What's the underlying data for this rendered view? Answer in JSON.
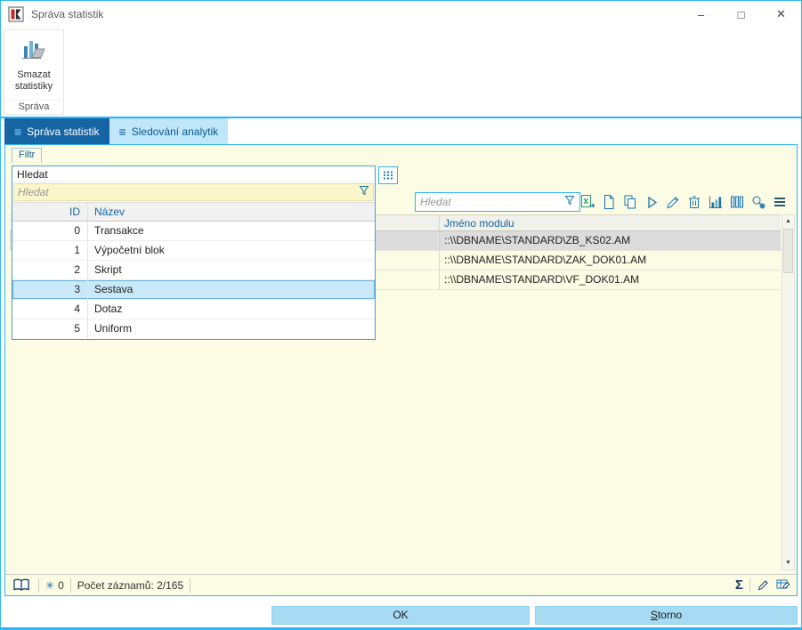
{
  "window": {
    "title": "Správa statistik",
    "controls": {
      "minimize": "–",
      "maximize": "□",
      "close": "✕"
    }
  },
  "ribbon": {
    "delete_button_label": "Smazat statistiky",
    "group_label": "Správa"
  },
  "tabs": [
    {
      "label": "Správa statistik",
      "active": true
    },
    {
      "label": "Sledování analytik",
      "active": false
    }
  ],
  "filter": {
    "label": "Filtr",
    "combo_value": "Hledat",
    "search_placeholder": "Hledat",
    "table": {
      "columns": [
        "ID",
        "Název"
      ],
      "rows": [
        {
          "id": "0",
          "name": "Transakce"
        },
        {
          "id": "1",
          "name": "Výpočetní blok"
        },
        {
          "id": "2",
          "name": "Skript"
        },
        {
          "id": "3",
          "name": "Sestava"
        },
        {
          "id": "4",
          "name": "Dotaz"
        },
        {
          "id": "5",
          "name": "Uniform"
        }
      ],
      "selected_row": "Sestava"
    }
  },
  "toolbar": {
    "search_placeholder": "Hledat",
    "icons": [
      "export-excel",
      "new-document",
      "copy",
      "run",
      "edit",
      "delete",
      "bar-chart",
      "columns",
      "search-settings",
      "menu"
    ]
  },
  "grid": {
    "columns": [
      "Jméno modulu"
    ],
    "rows": [
      "::\\\\DBNAME\\STANDARD\\ZB_KS02.AM",
      "::\\\\DBNAME\\STANDARD\\ZAK_DOK01.AM",
      "::\\\\DBNAME\\STANDARD\\VF_DOK01.AM"
    ]
  },
  "scrollbar": {
    "up": "▲",
    "down": "▼"
  },
  "statusbar": {
    "counter": "0",
    "records_label": "Počet záznamů: 2/165",
    "sigma_glyph": "Σ",
    "snowflake_glyph": "✳"
  },
  "footer": {
    "ok_label": "OK",
    "cancel_label": "Storno"
  },
  "glyphs": {
    "tab_menu": "≡"
  },
  "colors": {
    "accent": "#29B6F6",
    "tab_active_bg": "#1565A5",
    "selection_blue": "#C9E8F8",
    "selected_row_gray": "#DCDCDC",
    "panel_bg": "#FCFBE4",
    "icon_blue": "#1874A8",
    "navy": "#123F63",
    "button_bg": "#A7DBF4"
  }
}
